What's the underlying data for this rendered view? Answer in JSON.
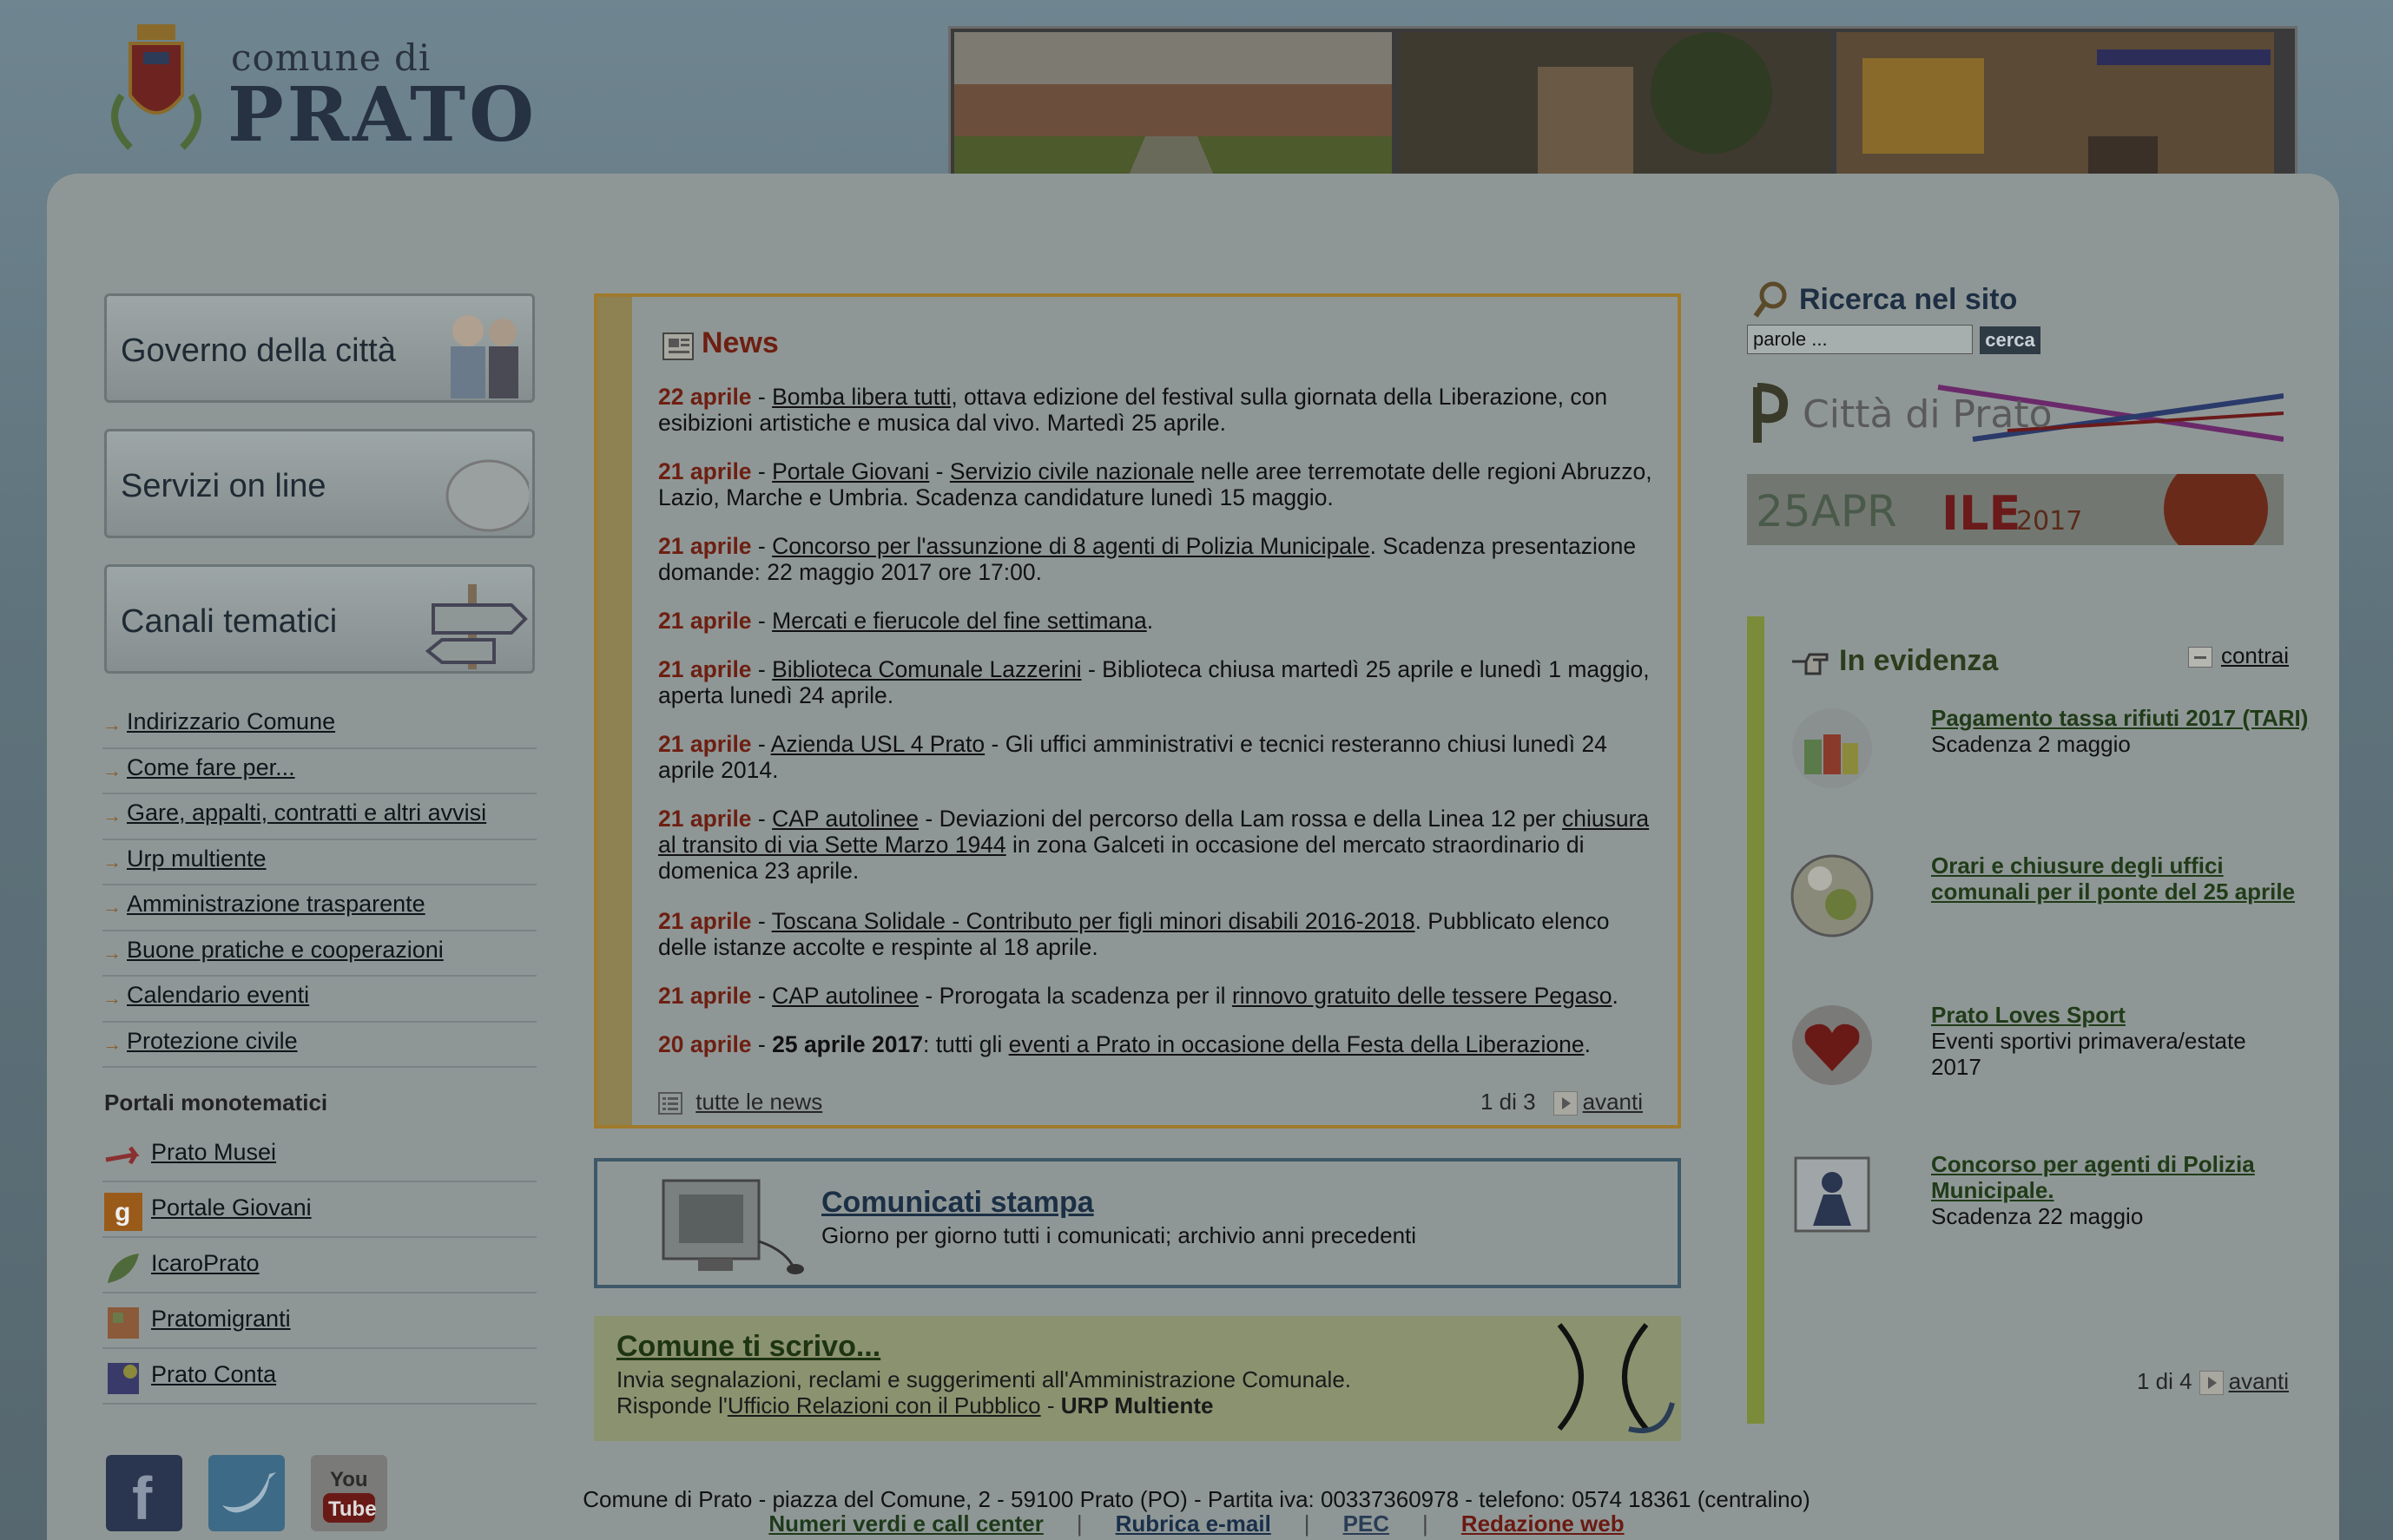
{
  "header": {
    "logo_line1": "comune di",
    "logo_line2": "PRATO"
  },
  "left_nav": {
    "big_buttons": [
      "Governo della città",
      "Servizi on line",
      "Canali tematici"
    ],
    "links": [
      "Indirizzario Comune",
      "Come fare per...",
      "Gare, appalti, contratti e altri avvisi",
      "Urp multiente",
      "Amministrazione trasparente",
      "Buone pratiche e cooperazioni",
      "Calendario eventi",
      "Protezione civile"
    ],
    "portali_title": "Portali monotematici",
    "portali": [
      "Prato Musei",
      "Portale Giovani",
      "IcaroPrato",
      "Pratomigranti",
      "Prato Conta"
    ]
  },
  "news": {
    "title": "News",
    "items": [
      {
        "date": "22 aprile",
        "sep": " - ",
        "link": "Bomba libera tutti",
        "text": ", ottava edizione del festival sulla giornata della Liberazione, con esibizioni artistiche e musica dal vivo. Martedì 25 aprile."
      },
      {
        "date": "21 aprile",
        "sep": " - ",
        "link": "Portale Giovani",
        "mid": " - ",
        "link2": "Servizio civile nazionale",
        "text": " nelle aree terremotate delle regioni Abruzzo, Lazio, Marche e Umbria. Scadenza candidature lunedì 15 maggio."
      },
      {
        "date": "21 aprile",
        "sep": " - ",
        "link": "Concorso per l'assunzione di 8 agenti di Polizia Municipale",
        "text": ". Scadenza presentazione domande: 22 maggio 2017  ore 17:00."
      },
      {
        "date": "21 aprile",
        "sep": " - ",
        "link": "Mercati e fierucole del fine settimana",
        "text": "."
      },
      {
        "date": "21 aprile",
        "sep": " - ",
        "link": "Biblioteca Comunale Lazzerini",
        "text": " - Biblioteca chiusa martedì 25 aprile e lunedì 1 maggio, aperta lunedì 24 aprile."
      },
      {
        "date": "21 aprile",
        "sep": " - ",
        "link": "Azienda USL 4 Prato",
        "text": " - Gli uffici amministrativi e tecnici resteranno chiusi lunedì 24 aprile 2014."
      },
      {
        "date": "21 aprile",
        "sep": " - ",
        "link": "CAP autolinee",
        "mid": " - Deviazioni del percorso della Lam rossa e della Linea 12 per ",
        "link2": "chiusura al transito di via Sette Marzo 1944",
        "text": " in zona Galceti in occasione del mercato straordinario di domenica 23 aprile."
      },
      {
        "date": "21 aprile",
        "sep": " - ",
        "link": "Toscana Solidale - Contributo per figli minori disabili 2016-2018",
        "text": ". Pubblicato elenco delle istanze accolte e respinte al 18 aprile."
      },
      {
        "date": "21 aprile",
        "sep": " - ",
        "link": "CAP autolinee",
        "mid": " - Prorogata la scadenza per il ",
        "link2": "rinnovo gratuito delle tessere Pegaso",
        "text": "."
      },
      {
        "date": "20 aprile",
        "sep": " - ",
        "bold": "25 aprile 2017",
        "mid": ": tutti gli ",
        "link2": "eventi a Prato in occasione della Festa della Liberazione",
        "text": "."
      }
    ],
    "all_news": "tutte le news",
    "page": "1 di 3",
    "next": "avanti"
  },
  "comunicati": {
    "title": "Comunicati stampa",
    "desc": "Giorno per giorno tutti i comunicati; archivio anni precedenti"
  },
  "scrivo": {
    "title": "Comune ti scrivo...",
    "line1": "Invia segnalazioni, reclami e suggerimenti all'Amministrazione Comunale.",
    "line2_pre": "Risponde l'",
    "line2_link": "Ufficio Relazioni con il Pubblico",
    "line2_mid": " - ",
    "line2_bold": "URP Multiente"
  },
  "search": {
    "title": "Ricerca nel sito",
    "placeholder": "parole ...",
    "button": "cerca"
  },
  "banners": {
    "citta": "Città di Prato",
    "aprile_a": "25APR",
    "aprile_b": "ILE",
    "aprile_year": "2017"
  },
  "evidenza": {
    "title": "In evidenza",
    "collapse": "contrai",
    "items": [
      {
        "title": "Pagamento tassa rifiuti 2017 (TARI)",
        "sub": "Scadenza 2 maggio"
      },
      {
        "title": "Orari e chiusure degli uffici comunali per il ponte del 25 aprile",
        "sub": ""
      },
      {
        "title": "Prato Loves Sport",
        "sub": "Eventi sportivi primavera/estate 2017"
      },
      {
        "title": "Concorso per agenti di Polizia Municipale.",
        "sub": "Scadenza 22 maggio"
      }
    ],
    "page": "1 di 4",
    "next": "avanti"
  },
  "footer": {
    "address": "Comune di Prato - piazza del Comune, 2 - 59100 Prato (PO) - Partita iva: 00337360978 - telefono: 0574 18361 (centralino)",
    "links": [
      "Numeri verdi e call center",
      "Rubrica e-mail",
      "PEC",
      "Redazione web"
    ],
    "sep": "|"
  },
  "colors": {
    "overlay": "#4e5b61",
    "news_date": "#6d1f12",
    "news_border": "#a07a2c",
    "evidenza_bar": "#7a8b3a",
    "footer_link_1": "#1d3a1a",
    "footer_link_2": "#1a2f4a",
    "footer_link_3": "#2a3d56",
    "footer_link_4": "#6a1a12"
  }
}
